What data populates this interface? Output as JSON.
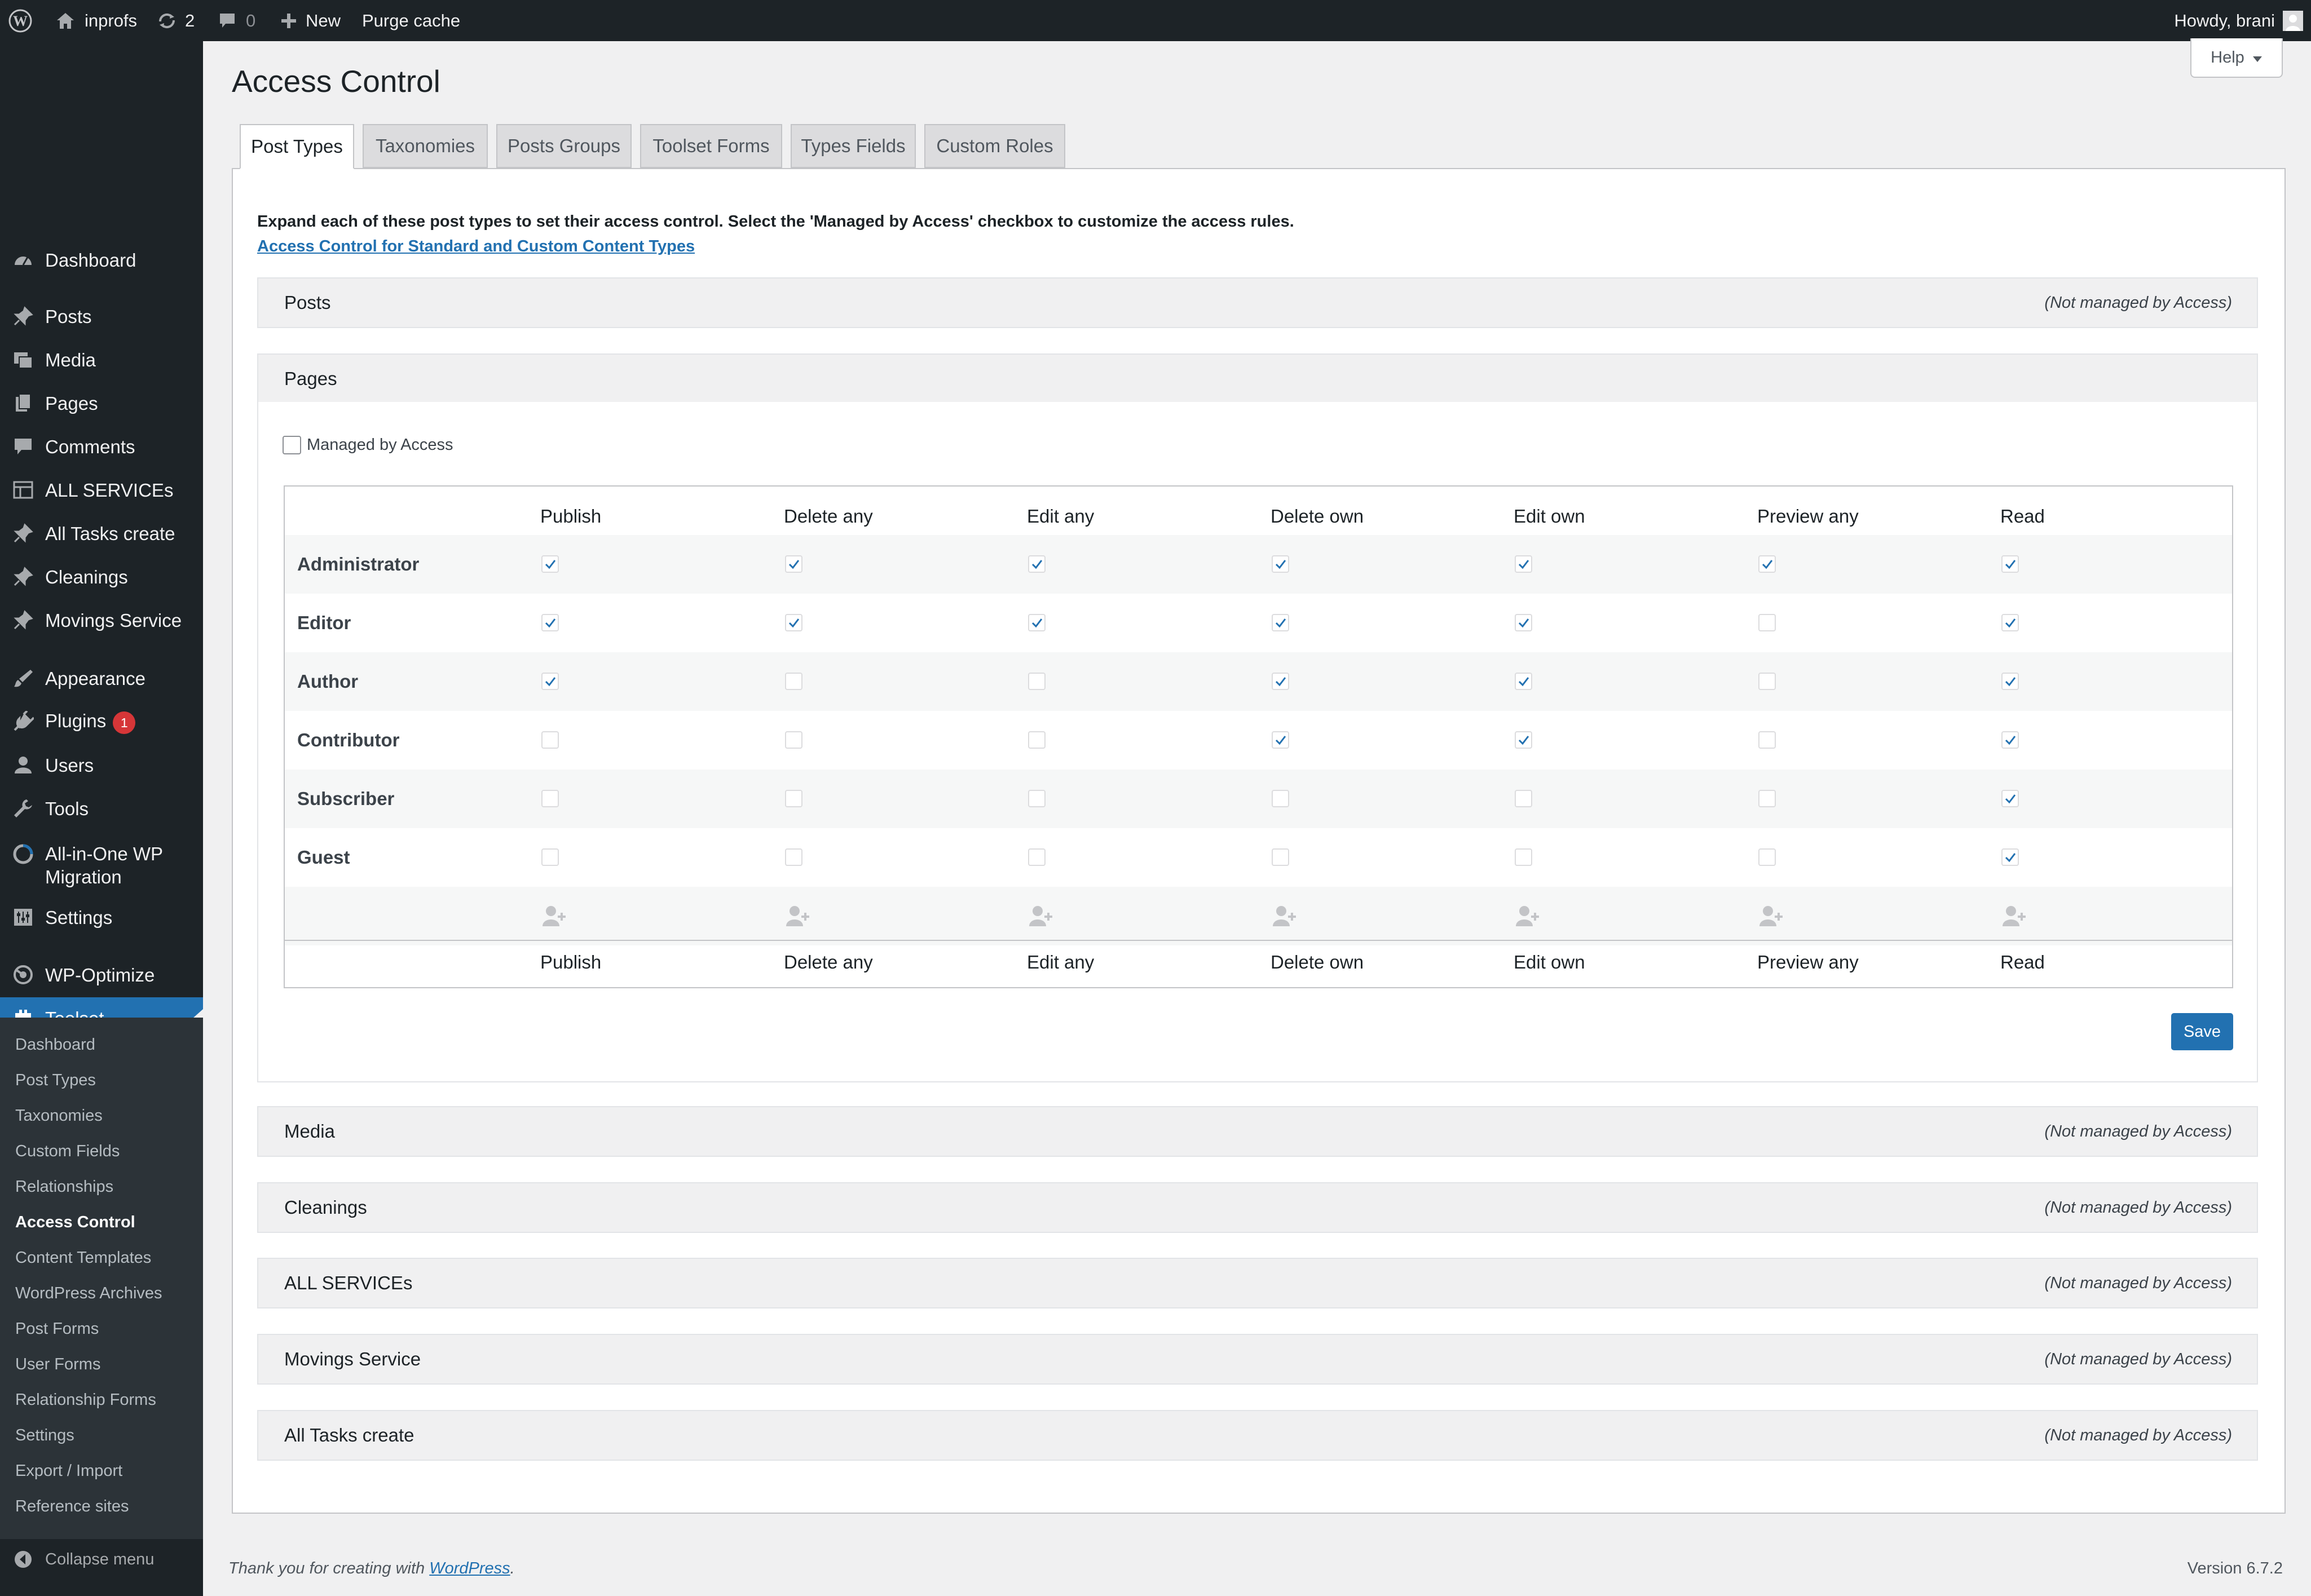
{
  "admin_bar": {
    "site_name": "inprofs",
    "updates_count": "2",
    "comments_count": "0",
    "new_label": "New",
    "purge_cache_label": "Purge cache",
    "howdy": "Howdy, brani"
  },
  "sidebar": {
    "items": [
      {
        "label": "Dashboard",
        "icon": "dashboard-icon"
      },
      {
        "label": "Posts",
        "icon": "pin-icon"
      },
      {
        "label": "Media",
        "icon": "media-icon"
      },
      {
        "label": "Pages",
        "icon": "pages-icon"
      },
      {
        "label": "Comments",
        "icon": "comments-icon"
      },
      {
        "label": "ALL SERVICEs",
        "icon": "grid-icon"
      },
      {
        "label": "All Tasks create",
        "icon": "pin-icon"
      },
      {
        "label": "Cleanings",
        "icon": "pin-icon"
      },
      {
        "label": "Movings Service",
        "icon": "pin-icon"
      },
      {
        "label": "Appearance",
        "icon": "brush-icon"
      },
      {
        "label": "Plugins",
        "icon": "plug-icon",
        "badge": "1"
      },
      {
        "label": "Users",
        "icon": "user-icon"
      },
      {
        "label": "Tools",
        "icon": "wrench-icon"
      },
      {
        "label": "All-in-One WP",
        "label2": "Migration",
        "icon": "migration-icon"
      },
      {
        "label": "Settings",
        "icon": "settings-icon"
      },
      {
        "label": "WP-Optimize",
        "icon": "optimize-icon"
      },
      {
        "label": "Toolset",
        "icon": "toolset-icon",
        "current": true
      }
    ],
    "submenu": [
      "Dashboard",
      "Post Types",
      "Taxonomies",
      "Custom Fields",
      "Relationships",
      "Access Control",
      "Content Templates",
      "WordPress Archives",
      "Post Forms",
      "User Forms",
      "Relationship Forms",
      "Settings",
      "Export / Import",
      "Reference sites"
    ],
    "submenu_active_index": 5,
    "collapse_label": "Collapse menu"
  },
  "help_label": "Help",
  "page_title": "Access Control",
  "tabs": [
    "Post Types",
    "Taxonomies",
    "Posts Groups",
    "Toolset Forms",
    "Types Fields",
    "Custom Roles"
  ],
  "intro_text": "Expand each of these post types to set their access control. Select the 'Managed by Access' checkbox to customize the access rules.",
  "intro_link": "Access Control for Standard and Custom Content Types",
  "not_managed_label": "(Not managed by Access)",
  "sections_top": [
    "Posts",
    "Pages"
  ],
  "sections_bottom": [
    "Media",
    "Cleanings",
    "ALL SERVICEs",
    "Movings Service",
    "All Tasks create"
  ],
  "pages_panel": {
    "managed_label": "Managed by Access",
    "managed_checked": false,
    "columns": [
      "Publish",
      "Delete any",
      "Edit any",
      "Delete own",
      "Edit own",
      "Preview any",
      "Read"
    ],
    "roles": [
      {
        "name": "Administrator",
        "perms": [
          true,
          true,
          true,
          true,
          true,
          true,
          true
        ]
      },
      {
        "name": "Editor",
        "perms": [
          true,
          true,
          true,
          true,
          true,
          false,
          true
        ]
      },
      {
        "name": "Author",
        "perms": [
          true,
          false,
          false,
          true,
          true,
          false,
          true
        ]
      },
      {
        "name": "Contributor",
        "perms": [
          false,
          false,
          false,
          true,
          true,
          false,
          true
        ]
      },
      {
        "name": "Subscriber",
        "perms": [
          false,
          false,
          false,
          false,
          false,
          false,
          true
        ]
      },
      {
        "name": "Guest",
        "perms": [
          false,
          false,
          false,
          false,
          false,
          false,
          true
        ]
      }
    ],
    "save_label": "Save"
  },
  "footer": {
    "thanks_prefix": "Thank you for creating with ",
    "thanks_link": "WordPress",
    "thanks_suffix": ".",
    "version": "Version 6.7.2"
  },
  "colors": {
    "admin_bar": "#1d2327",
    "sidebar": "#1d2327",
    "submenu": "#2c3338",
    "accent": "#2271b1",
    "badge": "#d63638",
    "page_bg": "#f0f0f1"
  }
}
